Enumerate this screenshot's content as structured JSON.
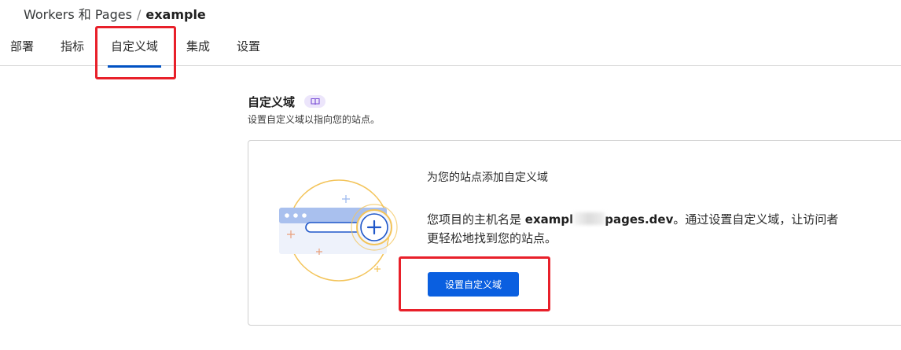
{
  "breadcrumb": {
    "parent": "Workers 和 Pages",
    "separator": "/",
    "current": "example"
  },
  "tabs": [
    {
      "label": "部署"
    },
    {
      "label": "指标"
    },
    {
      "label": "自定义域"
    },
    {
      "label": "集成"
    },
    {
      "label": "设置"
    }
  ],
  "active_tab": "自定义域",
  "section": {
    "title": "自定义域",
    "badge_icon": "book-icon",
    "subtitle": "设置自定义域以指向您的站点。"
  },
  "card": {
    "title": "为您的站点添加自定义域",
    "desc_prefix": "您项目的主机名是 ",
    "hostname_start": "exampl",
    "hostname_end": "pages.dev",
    "desc_suffix": "。通过设置自定义域，让访问者更轻松地找到您的站点。",
    "illustration_icon": "browser-add-domain-icon",
    "button_label": "设置自定义域"
  },
  "colors": {
    "accent": "#0051c3",
    "button": "#0a5fe0",
    "highlight": "#e8202a",
    "badge_bg": "#ece5fb",
    "illustration_circle": "#f3c45a"
  }
}
